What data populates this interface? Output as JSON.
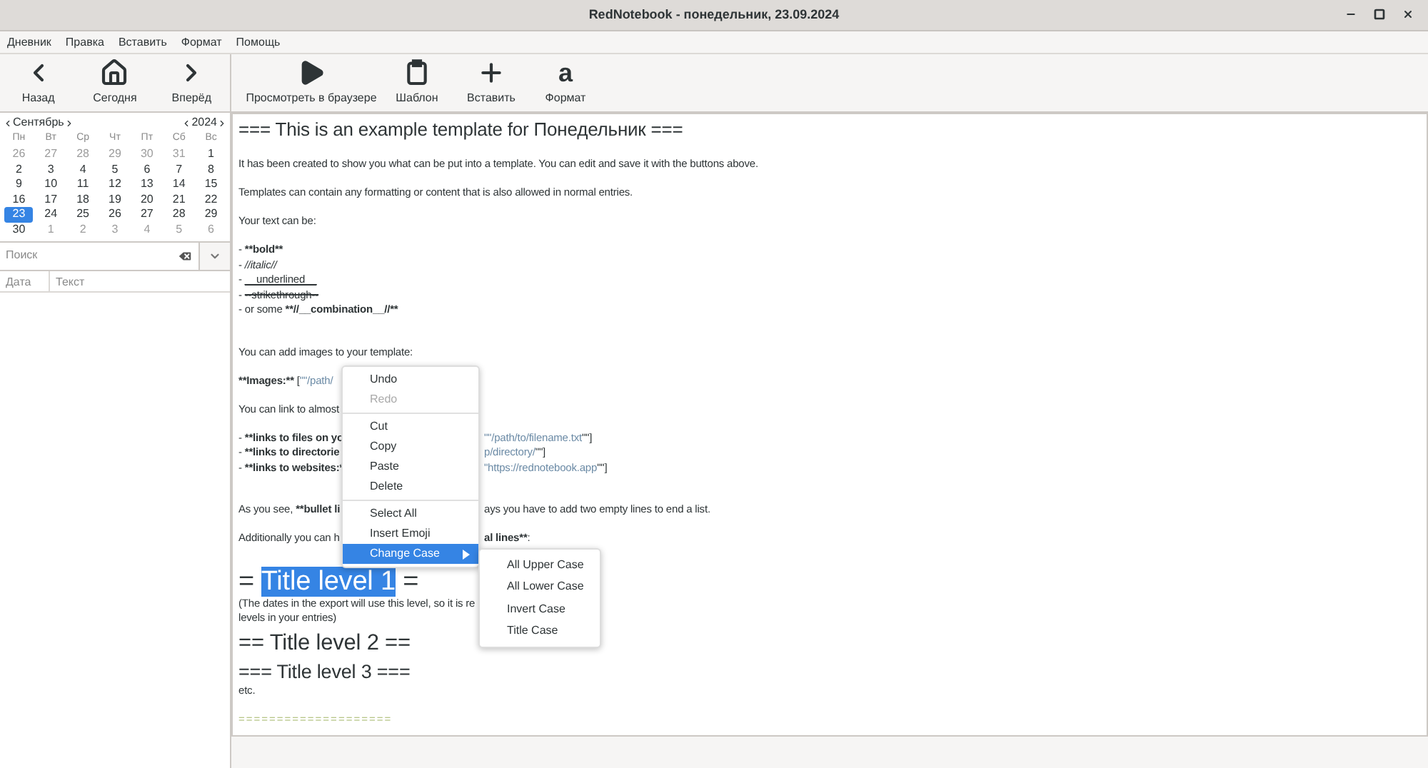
{
  "window": {
    "title": "RedNotebook - понедельник, 23.09.2024"
  },
  "menu_bar": [
    "Дневник",
    "Правка",
    "Вставить",
    "Формат",
    "Помощь"
  ],
  "nav_toolbar": [
    {
      "kind": "back",
      "label": "Назад"
    },
    {
      "kind": "home",
      "label": "Сегодня"
    },
    {
      "kind": "forward",
      "label": "Вперёд"
    }
  ],
  "edit_toolbar": [
    {
      "kind": "play",
      "label": "Просмотреть в браузере"
    },
    {
      "kind": "clipboard",
      "label": "Шаблон"
    },
    {
      "kind": "plus",
      "label": "Вставить"
    },
    {
      "kind": "glyph",
      "glyph": "a",
      "label": "Формат"
    }
  ],
  "calendar": {
    "month": "Сентябрь",
    "year": "2024",
    "weekdays": [
      "Пн",
      "Вт",
      "Ср",
      "Чт",
      "Пт",
      "Сб",
      "Вс"
    ],
    "weeks": [
      [
        {
          "day": "26",
          "outside": true,
          "selected": false
        },
        {
          "day": "27",
          "outside": true,
          "selected": false
        },
        {
          "day": "28",
          "outside": true,
          "selected": false
        },
        {
          "day": "29",
          "outside": true,
          "selected": false
        },
        {
          "day": "30",
          "outside": true,
          "selected": false
        },
        {
          "day": "31",
          "outside": true,
          "selected": false
        },
        {
          "day": "1",
          "outside": false,
          "selected": false
        }
      ],
      [
        {
          "day": "2",
          "outside": false,
          "selected": false
        },
        {
          "day": "3",
          "outside": false,
          "selected": false
        },
        {
          "day": "4",
          "outside": false,
          "selected": false
        },
        {
          "day": "5",
          "outside": false,
          "selected": false
        },
        {
          "day": "6",
          "outside": false,
          "selected": false
        },
        {
          "day": "7",
          "outside": false,
          "selected": false
        },
        {
          "day": "8",
          "outside": false,
          "selected": false
        }
      ],
      [
        {
          "day": "9",
          "outside": false,
          "selected": false
        },
        {
          "day": "10",
          "outside": false,
          "selected": false
        },
        {
          "day": "11",
          "outside": false,
          "selected": false
        },
        {
          "day": "12",
          "outside": false,
          "selected": false
        },
        {
          "day": "13",
          "outside": false,
          "selected": false
        },
        {
          "day": "14",
          "outside": false,
          "selected": false
        },
        {
          "day": "15",
          "outside": false,
          "selected": false
        }
      ],
      [
        {
          "day": "16",
          "outside": false,
          "selected": false
        },
        {
          "day": "17",
          "outside": false,
          "selected": false
        },
        {
          "day": "18",
          "outside": false,
          "selected": false
        },
        {
          "day": "19",
          "outside": false,
          "selected": false
        },
        {
          "day": "20",
          "outside": false,
          "selected": false
        },
        {
          "day": "21",
          "outside": false,
          "selected": false
        },
        {
          "day": "22",
          "outside": false,
          "selected": false
        }
      ],
      [
        {
          "day": "23",
          "outside": false,
          "selected": true
        },
        {
          "day": "24",
          "outside": false,
          "selected": false
        },
        {
          "day": "25",
          "outside": false,
          "selected": false
        },
        {
          "day": "26",
          "outside": false,
          "selected": false
        },
        {
          "day": "27",
          "outside": false,
          "selected": false
        },
        {
          "day": "28",
          "outside": false,
          "selected": false
        },
        {
          "day": "29",
          "outside": false,
          "selected": false
        }
      ],
      [
        {
          "day": "30",
          "outside": false,
          "selected": false
        },
        {
          "day": "1",
          "outside": true,
          "selected": false
        },
        {
          "day": "2",
          "outside": true,
          "selected": false
        },
        {
          "day": "3",
          "outside": true,
          "selected": false
        },
        {
          "day": "4",
          "outside": true,
          "selected": false
        },
        {
          "day": "5",
          "outside": true,
          "selected": false
        },
        {
          "day": "6",
          "outside": true,
          "selected": false
        }
      ]
    ]
  },
  "search": {
    "placeholder": "Поиск"
  },
  "entries_table": {
    "columns": [
      "Дата",
      "Текст"
    ]
  },
  "editor": [
    {
      "kind": "h0",
      "left": [
        {
          "text": "=== This is an example template for Понедельник ==="
        }
      ]
    },
    {
      "kind": "para",
      "left": [
        {
          "text": "It has been created to show you what can be put into a template. You can edit and save it with the buttons above."
        }
      ]
    },
    {
      "kind": "para",
      "left": [
        {
          "text": "Templates can contain any formatting or content that is also allowed in normal entries."
        }
      ]
    },
    {
      "kind": "para",
      "left": [
        {
          "text": "Your text can be:"
        }
      ]
    },
    {
      "kind": "item",
      "left": [
        {
          "text": "- "
        },
        {
          "text": "**bold**",
          "kind": "bold"
        }
      ]
    },
    {
      "kind": "item",
      "left": [
        {
          "text": "- "
        },
        {
          "text": "//italic//",
          "kind": "italic"
        }
      ]
    },
    {
      "kind": "item",
      "left": [
        {
          "text": "- "
        },
        {
          "text": "__underlined__",
          "kind": "underline"
        }
      ]
    },
    {
      "kind": "item",
      "left": [
        {
          "text": "- "
        },
        {
          "text": "--strikethrough--",
          "kind": "strike"
        }
      ]
    },
    {
      "kind": "item",
      "left": [
        {
          "text": "- or some "
        },
        {
          "text": "**//__combination__//**",
          "kind": "bold"
        }
      ]
    },
    {
      "kind": "after_list",
      "left": [
        {
          "text": "You can add images to your template:"
        }
      ]
    },
    {
      "kind": "para",
      "left": [
        {
          "text": "**Images:**",
          "kind": "bold"
        },
        {
          "text": " ["
        },
        {
          "text": "\"\"/path/",
          "kind": "link"
        }
      ]
    },
    {
      "kind": "para",
      "left": [
        {
          "text": "You can link to almost"
        }
      ]
    },
    {
      "kind": "item",
      "left": [
        {
          "text": "- "
        },
        {
          "text": "**links to files on yo",
          "kind": "bold"
        }
      ],
      "right": [
        {
          "text": "\"\"/path/to/filename.txt",
          "kind": "link"
        },
        {
          "text": "\"\"]"
        }
      ]
    },
    {
      "kind": "item",
      "left": [
        {
          "text": "- "
        },
        {
          "text": "**links to directorie",
          "kind": "bold"
        }
      ],
      "right": [
        {
          "text": "p/directory/",
          "kind": "link"
        },
        {
          "text": "\"\"]"
        }
      ]
    },
    {
      "kind": "item",
      "left": [
        {
          "text": "- "
        },
        {
          "text": "**links to websites:*",
          "kind": "bold"
        }
      ],
      "right": [
        {
          "text": "\"https://rednotebook.app",
          "kind": "link"
        },
        {
          "text": "\"\"]"
        }
      ]
    },
    {
      "kind": "after_list",
      "left": [
        {
          "text": "As you see, "
        },
        {
          "text": "**bullet li",
          "kind": "bold"
        }
      ],
      "right": [
        {
          "text": "ays you have to add two empty lines to end a list."
        }
      ]
    },
    {
      "kind": "para",
      "left": [
        {
          "text": "Additionally you can h"
        }
      ],
      "right": [
        {
          "text": "al lines**",
          "kind": "bold"
        },
        {
          "text": ":"
        }
      ]
    },
    {
      "kind": "h1",
      "left": [
        {
          "text": "= "
        },
        {
          "text": "Title level 1",
          "kind": "highlight"
        },
        {
          "text": " ="
        }
      ]
    },
    {
      "kind": "note",
      "left": [
        {
          "text": "(The dates in the export will use this level, so it is re"
        }
      ]
    },
    {
      "kind": "note",
      "left": [
        {
          "text": "levels in your entries)"
        }
      ]
    },
    {
      "kind": "h2",
      "left": [
        {
          "text": "== Title level 2 =="
        }
      ]
    },
    {
      "kind": "h3",
      "left": [
        {
          "text": "=== Title level 3 ==="
        }
      ]
    },
    {
      "kind": "note",
      "left": [
        {
          "text": "etc."
        }
      ]
    },
    {
      "kind": "rule",
      "left": [
        {
          "text": "===================="
        }
      ]
    }
  ],
  "context_menu": {
    "items": [
      {
        "label": "Undo",
        "disabled": false,
        "selected": false
      },
      {
        "label": "Redo",
        "disabled": true,
        "selected": false
      },
      {
        "kind": "separator"
      },
      {
        "label": "Cut",
        "disabled": false,
        "selected": false
      },
      {
        "label": "Copy",
        "disabled": false,
        "selected": false
      },
      {
        "label": "Paste",
        "disabled": false,
        "selected": false
      },
      {
        "label": "Delete",
        "disabled": false,
        "selected": false
      },
      {
        "kind": "separator"
      },
      {
        "label": "Select All",
        "disabled": false,
        "selected": false
      },
      {
        "label": "Insert Emoji",
        "disabled": false,
        "selected": false
      },
      {
        "label": "Change Case",
        "disabled": false,
        "selected": true,
        "submenu": true
      }
    ],
    "submenu": [
      "All Upper Case",
      "All Lower Case",
      "Invert Case",
      "Title Case"
    ]
  }
}
